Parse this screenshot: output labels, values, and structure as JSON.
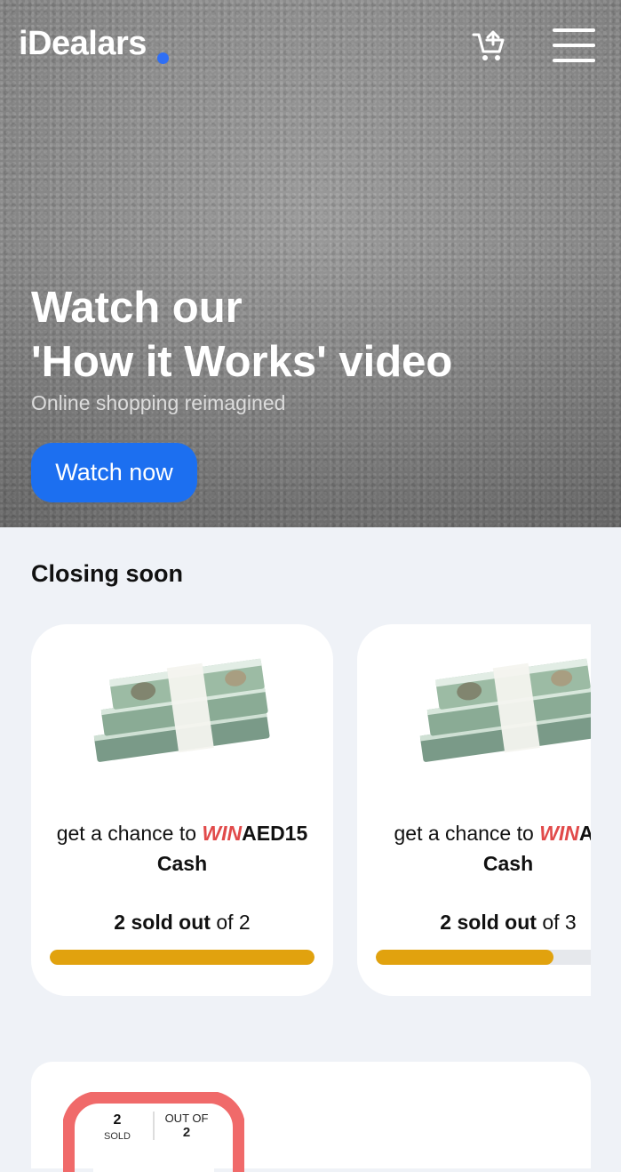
{
  "header": {
    "logo": "iDealars"
  },
  "hero": {
    "title_line1": "Watch our",
    "title_line2": "'How it Works' video",
    "subtitle": "Online shopping reimagined",
    "cta_label": "Watch now"
  },
  "section": {
    "title": "Closing soon"
  },
  "cards": [
    {
      "prefix": "get a chance to",
      "win": "WIN",
      "prize": "AED15",
      "prize_line2": "Cash",
      "sold_count": "2 sold out",
      "sold_suffix": "of 2",
      "progress_percent": 100
    },
    {
      "prefix": "get a chance to",
      "win": "WIN",
      "prize": "AED",
      "prize_line2": "Cash",
      "sold_count": "2 sold out",
      "sold_suffix": "of 3",
      "progress_percent": 67
    }
  ],
  "bottom_card": {
    "sold_value": "2",
    "sold_label": "SOLD",
    "out_of_label": "OUT OF",
    "total_value": "2"
  },
  "colors": {
    "accent_blue": "#1c6ff0",
    "win_red": "#e14a4a",
    "progress_gold": "#e1a20e",
    "counter_red": "#f06a6a"
  },
  "icons": {
    "cart": "cart-add-icon",
    "menu": "hamburger-menu-icon",
    "prize_image": "cash-stack-icon"
  }
}
